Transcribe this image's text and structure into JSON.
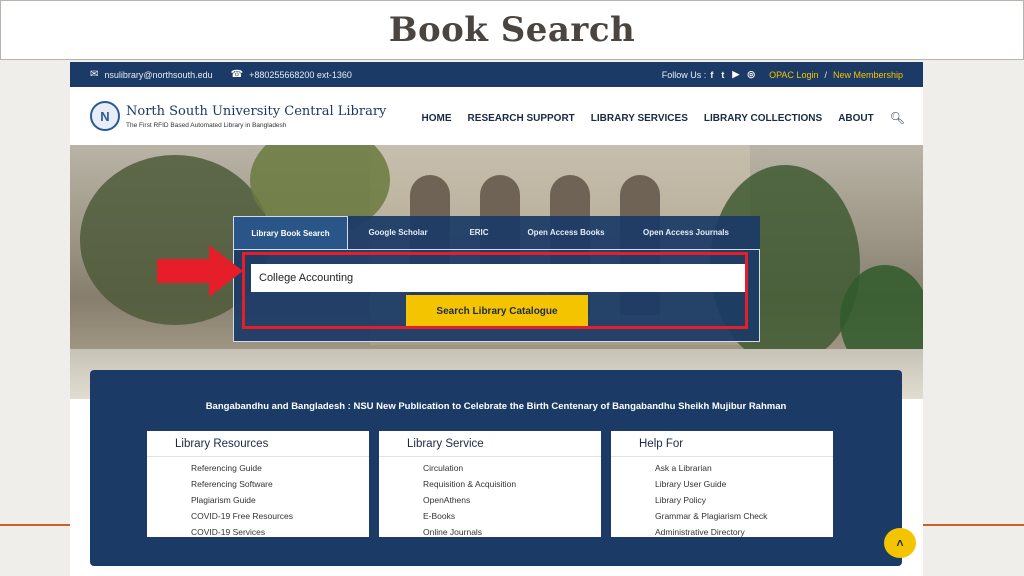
{
  "slide": {
    "title": "Book Search"
  },
  "topbar": {
    "email": "nsulibrary@northsouth.edu",
    "phone": "+880255668200 ext-1360",
    "follow_label": "Follow Us :",
    "social_icons": [
      "facebook-icon",
      "twitter-icon",
      "youtube-icon",
      "instagram-icon"
    ],
    "opac_login": "OPAC Login",
    "separator": "/",
    "new_membership": "New Membership"
  },
  "header": {
    "library_name": "North South University Central Library",
    "tagline": "The First RFID Based Automated Library in Bangladesh",
    "nav": [
      "HOME",
      "RESEARCH SUPPORT",
      "LIBRARY SERVICES",
      "LIBRARY COLLECTIONS",
      "ABOUT"
    ]
  },
  "search": {
    "tabs": [
      "Library Book Search",
      "Google Scholar",
      "ERIC",
      "Open Access Books",
      "Open Access Journals"
    ],
    "active_tab": "Library Book Search",
    "query": "College Accounting",
    "button_label": "Search Library Catalogue"
  },
  "info": {
    "headline": "Bangabandhu and Bangladesh : NSU New Publication to Celebrate the Birth Centenary of Bangabandhu Sheikh Mujibur Rahman",
    "cards": [
      {
        "title": "Library Resources",
        "items": [
          "Referencing Guide",
          "Referencing Software",
          "Plagiarism Guide",
          "COVID-19 Free Resources",
          "COVID-19 Services"
        ]
      },
      {
        "title": "Library Service",
        "items": [
          "Circulation",
          "Requisition & Acquisition",
          "OpenAthens",
          "E-Books",
          "Online Journals"
        ]
      },
      {
        "title": "Help For",
        "items": [
          "Ask a Librarian",
          "Library User Guide",
          "Library Policy",
          "Grammar & Plagiarism Check",
          "Administrative Directory"
        ]
      }
    ]
  },
  "colors": {
    "navy": "#1b3a66",
    "accent_yellow": "#f5c400",
    "highlight_red": "#e51e2a",
    "deco_orange": "#c9602e"
  }
}
